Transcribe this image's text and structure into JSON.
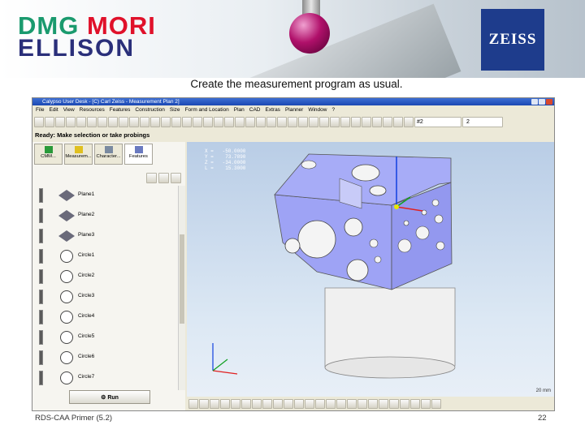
{
  "header": {
    "logo_line1_a": "DMG",
    "logo_line1_b": "MORI",
    "logo_line2": "ELLISON",
    "zeiss_logo": "ZEISS"
  },
  "subtitle": "Create the measurement program as usual.",
  "app": {
    "title": "Calypso User Desk - [C) Carl Zeiss - Measurement Plan 2]",
    "menu": [
      "File",
      "Edit",
      "View",
      "Resources",
      "Features",
      "Construction",
      "Size",
      "Form and Location",
      "Plan",
      "CAD",
      "Extras",
      "Planner",
      "Window",
      "?"
    ],
    "toolbar_select1": "#2",
    "toolbar_select2": "2",
    "status": "Ready: Make selection or take probings",
    "tabs": [
      {
        "label": "CMM...",
        "icon": "probe-icon"
      },
      {
        "label": "Measurem...",
        "icon": "folder-icon"
      },
      {
        "label": "Character...",
        "icon": "list-icon"
      },
      {
        "label": "Features",
        "icon": "features-icon"
      }
    ],
    "features": [
      {
        "label": "Plane1",
        "type": "plane"
      },
      {
        "label": "Plane2",
        "type": "plane"
      },
      {
        "label": "Plane3",
        "type": "plane"
      },
      {
        "label": "Circle1",
        "type": "circle"
      },
      {
        "label": "Circle2",
        "type": "circle"
      },
      {
        "label": "Circle3",
        "type": "circle"
      },
      {
        "label": "Circle4",
        "type": "circle"
      },
      {
        "label": "Circle5",
        "type": "circle"
      },
      {
        "label": "Circle6",
        "type": "circle"
      },
      {
        "label": "Circle7",
        "type": "circle"
      }
    ],
    "run_label": "Run",
    "coords": "X =   -50.0000\nY =    73.7890\nZ =   -34.0000\nL =    15.3000",
    "viewport_scale": "20 mm"
  },
  "footer": {
    "left": "RDS-CAA Primer (5.2)",
    "page": "22"
  },
  "colors": {
    "part_face": "#9a9ff5",
    "cylinder": "#f2f2f2",
    "zeiss_blue": "#1e3c8c",
    "mori_red": "#e0112a",
    "dmg_green": "#1a9a6e",
    "ellison_navy": "#2a2f7a"
  }
}
